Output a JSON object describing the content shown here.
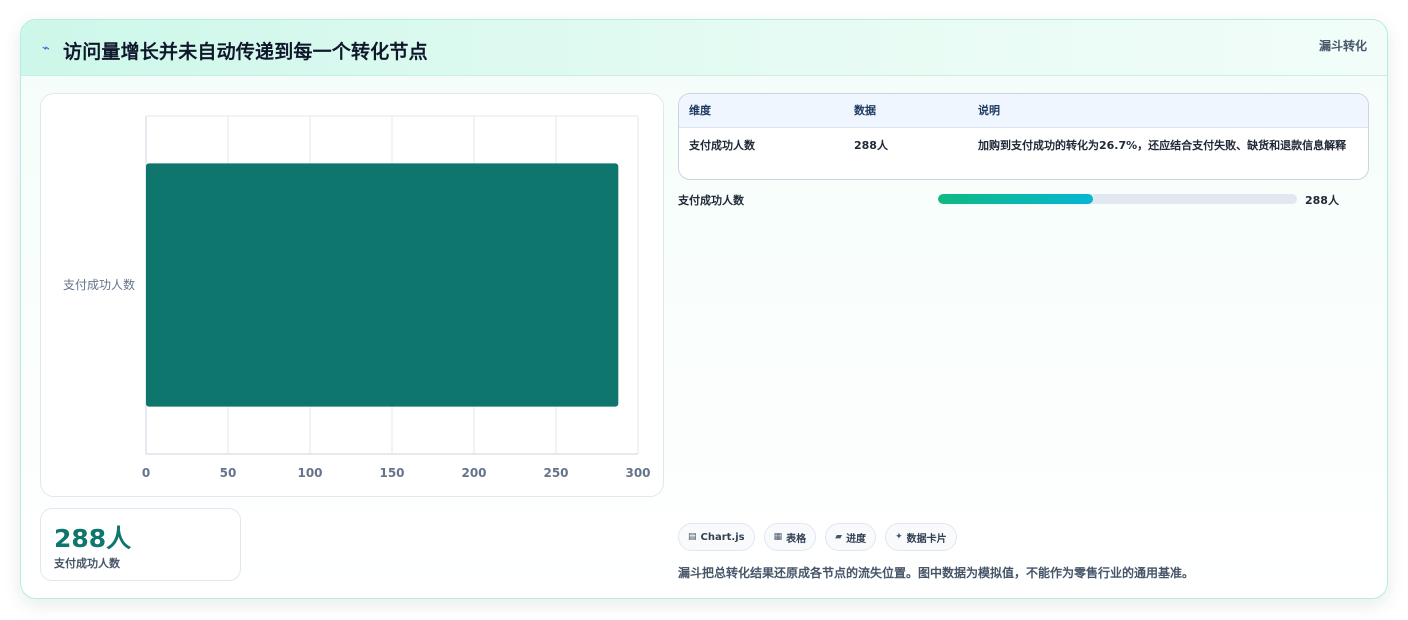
{
  "header": {
    "title": "访问量增长并未自动传递到每一个转化节点",
    "tag": "漏斗转化",
    "bolt_icon": "⌁"
  },
  "chart_data": {
    "type": "bar",
    "orientation": "horizontal",
    "categories": [
      "支付成功人数"
    ],
    "values": [
      288
    ],
    "xlim": [
      0,
      300
    ],
    "xticks": [
      0,
      50,
      100,
      150,
      200,
      250,
      300
    ],
    "grid": true,
    "bar_color": "#0f766e"
  },
  "kpi": {
    "value": "288人",
    "label": "支付成功人数"
  },
  "table": {
    "headers": [
      "维度",
      "数据",
      "说明"
    ],
    "rows": [
      [
        "支付成功人数",
        "288人",
        "加购到支付成功的转化为26.7%，还应结合支付失败、缺货和退款信息解释"
      ]
    ]
  },
  "progress": {
    "label": "支付成功人数",
    "value_text": "288人",
    "fraction": 0.433
  },
  "chips": [
    {
      "icon": "▤",
      "label": "Chart.js"
    },
    {
      "icon": "▦",
      "label": "表格"
    },
    {
      "icon": "▰",
      "label": "进度"
    },
    {
      "icon": "✦",
      "label": "数据卡片"
    }
  ],
  "note": "漏斗把总转化结果还原成各节点的流失位置。图中数据为模拟值，不能作为零售行业的通用基准。"
}
